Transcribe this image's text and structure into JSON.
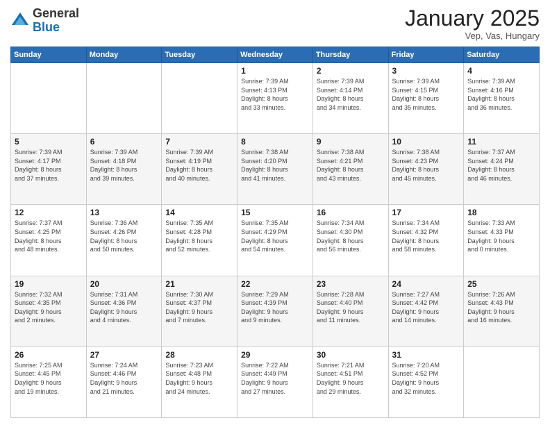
{
  "header": {
    "logo_general": "General",
    "logo_blue": "Blue",
    "month_title": "January 2025",
    "location": "Vep, Vas, Hungary"
  },
  "days_of_week": [
    "Sunday",
    "Monday",
    "Tuesday",
    "Wednesday",
    "Thursday",
    "Friday",
    "Saturday"
  ],
  "weeks": [
    [
      {
        "day": "",
        "info": ""
      },
      {
        "day": "",
        "info": ""
      },
      {
        "day": "",
        "info": ""
      },
      {
        "day": "1",
        "info": "Sunrise: 7:39 AM\nSunset: 4:13 PM\nDaylight: 8 hours\nand 33 minutes."
      },
      {
        "day": "2",
        "info": "Sunrise: 7:39 AM\nSunset: 4:14 PM\nDaylight: 8 hours\nand 34 minutes."
      },
      {
        "day": "3",
        "info": "Sunrise: 7:39 AM\nSunset: 4:15 PM\nDaylight: 8 hours\nand 35 minutes."
      },
      {
        "day": "4",
        "info": "Sunrise: 7:39 AM\nSunset: 4:16 PM\nDaylight: 8 hours\nand 36 minutes."
      }
    ],
    [
      {
        "day": "5",
        "info": "Sunrise: 7:39 AM\nSunset: 4:17 PM\nDaylight: 8 hours\nand 37 minutes."
      },
      {
        "day": "6",
        "info": "Sunrise: 7:39 AM\nSunset: 4:18 PM\nDaylight: 8 hours\nand 39 minutes."
      },
      {
        "day": "7",
        "info": "Sunrise: 7:39 AM\nSunset: 4:19 PM\nDaylight: 8 hours\nand 40 minutes."
      },
      {
        "day": "8",
        "info": "Sunrise: 7:38 AM\nSunset: 4:20 PM\nDaylight: 8 hours\nand 41 minutes."
      },
      {
        "day": "9",
        "info": "Sunrise: 7:38 AM\nSunset: 4:21 PM\nDaylight: 8 hours\nand 43 minutes."
      },
      {
        "day": "10",
        "info": "Sunrise: 7:38 AM\nSunset: 4:23 PM\nDaylight: 8 hours\nand 45 minutes."
      },
      {
        "day": "11",
        "info": "Sunrise: 7:37 AM\nSunset: 4:24 PM\nDaylight: 8 hours\nand 46 minutes."
      }
    ],
    [
      {
        "day": "12",
        "info": "Sunrise: 7:37 AM\nSunset: 4:25 PM\nDaylight: 8 hours\nand 48 minutes."
      },
      {
        "day": "13",
        "info": "Sunrise: 7:36 AM\nSunset: 4:26 PM\nDaylight: 8 hours\nand 50 minutes."
      },
      {
        "day": "14",
        "info": "Sunrise: 7:35 AM\nSunset: 4:28 PM\nDaylight: 8 hours\nand 52 minutes."
      },
      {
        "day": "15",
        "info": "Sunrise: 7:35 AM\nSunset: 4:29 PM\nDaylight: 8 hours\nand 54 minutes."
      },
      {
        "day": "16",
        "info": "Sunrise: 7:34 AM\nSunset: 4:30 PM\nDaylight: 8 hours\nand 56 minutes."
      },
      {
        "day": "17",
        "info": "Sunrise: 7:34 AM\nSunset: 4:32 PM\nDaylight: 8 hours\nand 58 minutes."
      },
      {
        "day": "18",
        "info": "Sunrise: 7:33 AM\nSunset: 4:33 PM\nDaylight: 9 hours\nand 0 minutes."
      }
    ],
    [
      {
        "day": "19",
        "info": "Sunrise: 7:32 AM\nSunset: 4:35 PM\nDaylight: 9 hours\nand 2 minutes."
      },
      {
        "day": "20",
        "info": "Sunrise: 7:31 AM\nSunset: 4:36 PM\nDaylight: 9 hours\nand 4 minutes."
      },
      {
        "day": "21",
        "info": "Sunrise: 7:30 AM\nSunset: 4:37 PM\nDaylight: 9 hours\nand 7 minutes."
      },
      {
        "day": "22",
        "info": "Sunrise: 7:29 AM\nSunset: 4:39 PM\nDaylight: 9 hours\nand 9 minutes."
      },
      {
        "day": "23",
        "info": "Sunrise: 7:28 AM\nSunset: 4:40 PM\nDaylight: 9 hours\nand 11 minutes."
      },
      {
        "day": "24",
        "info": "Sunrise: 7:27 AM\nSunset: 4:42 PM\nDaylight: 9 hours\nand 14 minutes."
      },
      {
        "day": "25",
        "info": "Sunrise: 7:26 AM\nSunset: 4:43 PM\nDaylight: 9 hours\nand 16 minutes."
      }
    ],
    [
      {
        "day": "26",
        "info": "Sunrise: 7:25 AM\nSunset: 4:45 PM\nDaylight: 9 hours\nand 19 minutes."
      },
      {
        "day": "27",
        "info": "Sunrise: 7:24 AM\nSunset: 4:46 PM\nDaylight: 9 hours\nand 21 minutes."
      },
      {
        "day": "28",
        "info": "Sunrise: 7:23 AM\nSunset: 4:48 PM\nDaylight: 9 hours\nand 24 minutes."
      },
      {
        "day": "29",
        "info": "Sunrise: 7:22 AM\nSunset: 4:49 PM\nDaylight: 9 hours\nand 27 minutes."
      },
      {
        "day": "30",
        "info": "Sunrise: 7:21 AM\nSunset: 4:51 PM\nDaylight: 9 hours\nand 29 minutes."
      },
      {
        "day": "31",
        "info": "Sunrise: 7:20 AM\nSunset: 4:52 PM\nDaylight: 9 hours\nand 32 minutes."
      },
      {
        "day": "",
        "info": ""
      }
    ]
  ]
}
